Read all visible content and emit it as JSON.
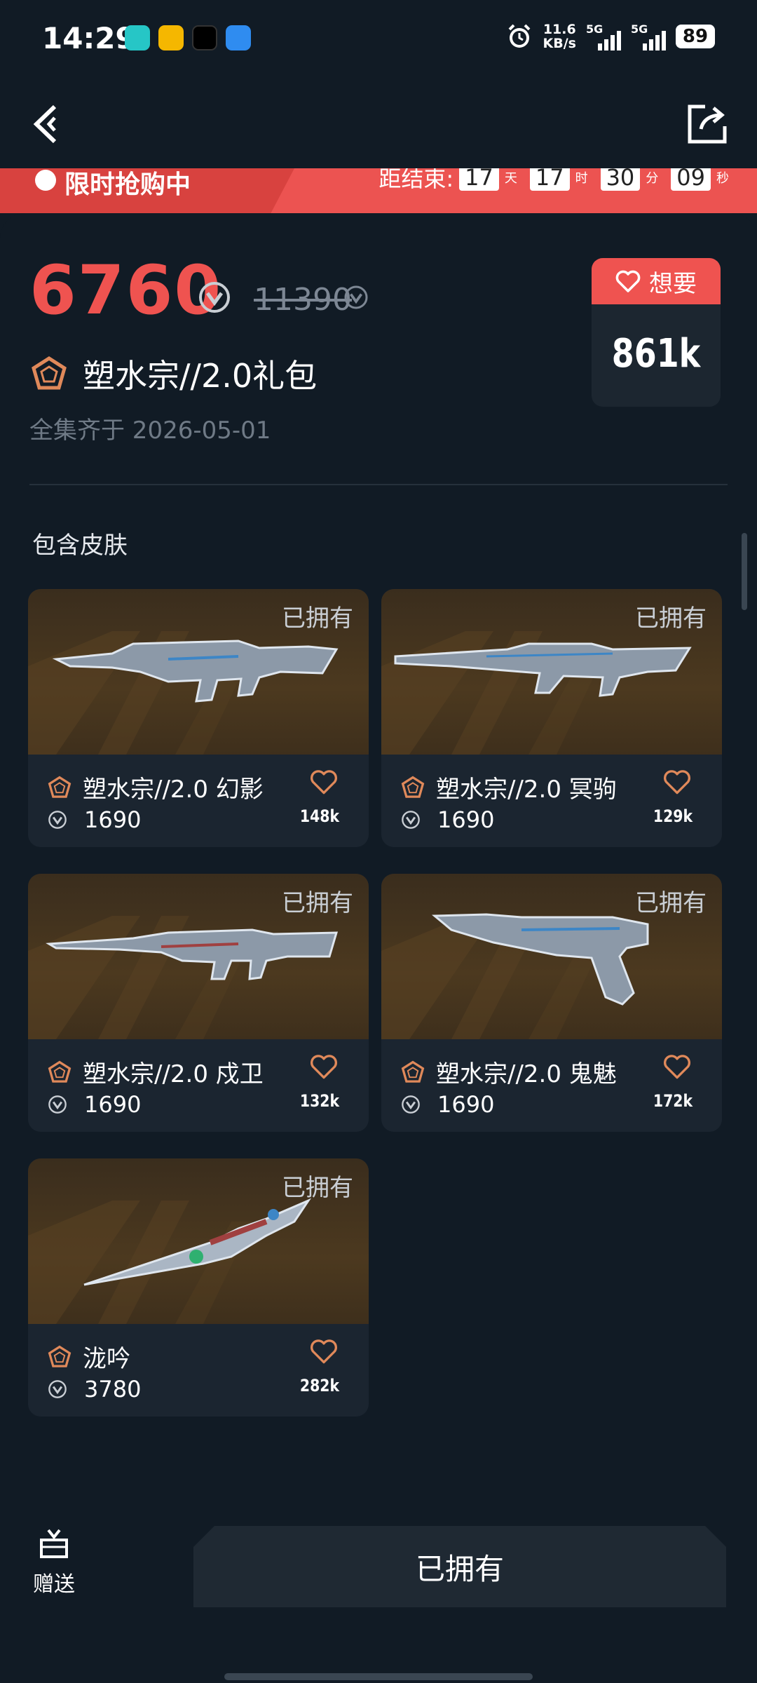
{
  "status_bar": {
    "time": "14:29",
    "speed_value": "11.6",
    "speed_unit": "KB/s",
    "net1": "5G",
    "net2": "5G",
    "battery": "89"
  },
  "nav": {
    "back_icon": "back-arrow-icon",
    "share_icon": "share-icon"
  },
  "promo": {
    "title": "限时抢购中",
    "countdown_label": "距结束:",
    "days": "17",
    "days_unit": "天",
    "hours": "17",
    "hours_unit": "时",
    "minutes": "30",
    "minutes_unit": "分",
    "seconds": "09",
    "seconds_unit": "秒"
  },
  "bundle": {
    "price": "6760",
    "original_price": "11390",
    "name": "塑水宗//2.0礼包",
    "collect_date": "全集齐于 2026-05-01",
    "want_label": "想要",
    "want_count": "861k"
  },
  "section": {
    "title": "包含皮肤"
  },
  "skins": [
    {
      "name": "塑水宗//2.0 幻影",
      "price": "1690",
      "likes": "148k",
      "owned": "已拥有",
      "weapon": "rifle"
    },
    {
      "name": "塑水宗//2.0 冥驹",
      "price": "1690",
      "likes": "129k",
      "owned": "已拥有",
      "weapon": "sniper"
    },
    {
      "name": "塑水宗//2.0 戍卫",
      "price": "1690",
      "likes": "132k",
      "owned": "已拥有",
      "weapon": "rifle-long"
    },
    {
      "name": "塑水宗//2.0 鬼魅",
      "price": "1690",
      "likes": "172k",
      "owned": "已拥有",
      "weapon": "pistol"
    },
    {
      "name": "泷吟",
      "price": "3780",
      "likes": "282k",
      "owned": "已拥有",
      "weapon": "knife"
    }
  ],
  "bottom": {
    "gift_label": "赠送",
    "buy_label": "已拥有"
  },
  "colors": {
    "accent": "#ef5350",
    "background": "#111b25",
    "card": "#1b2530",
    "tier": "#e0895a"
  }
}
